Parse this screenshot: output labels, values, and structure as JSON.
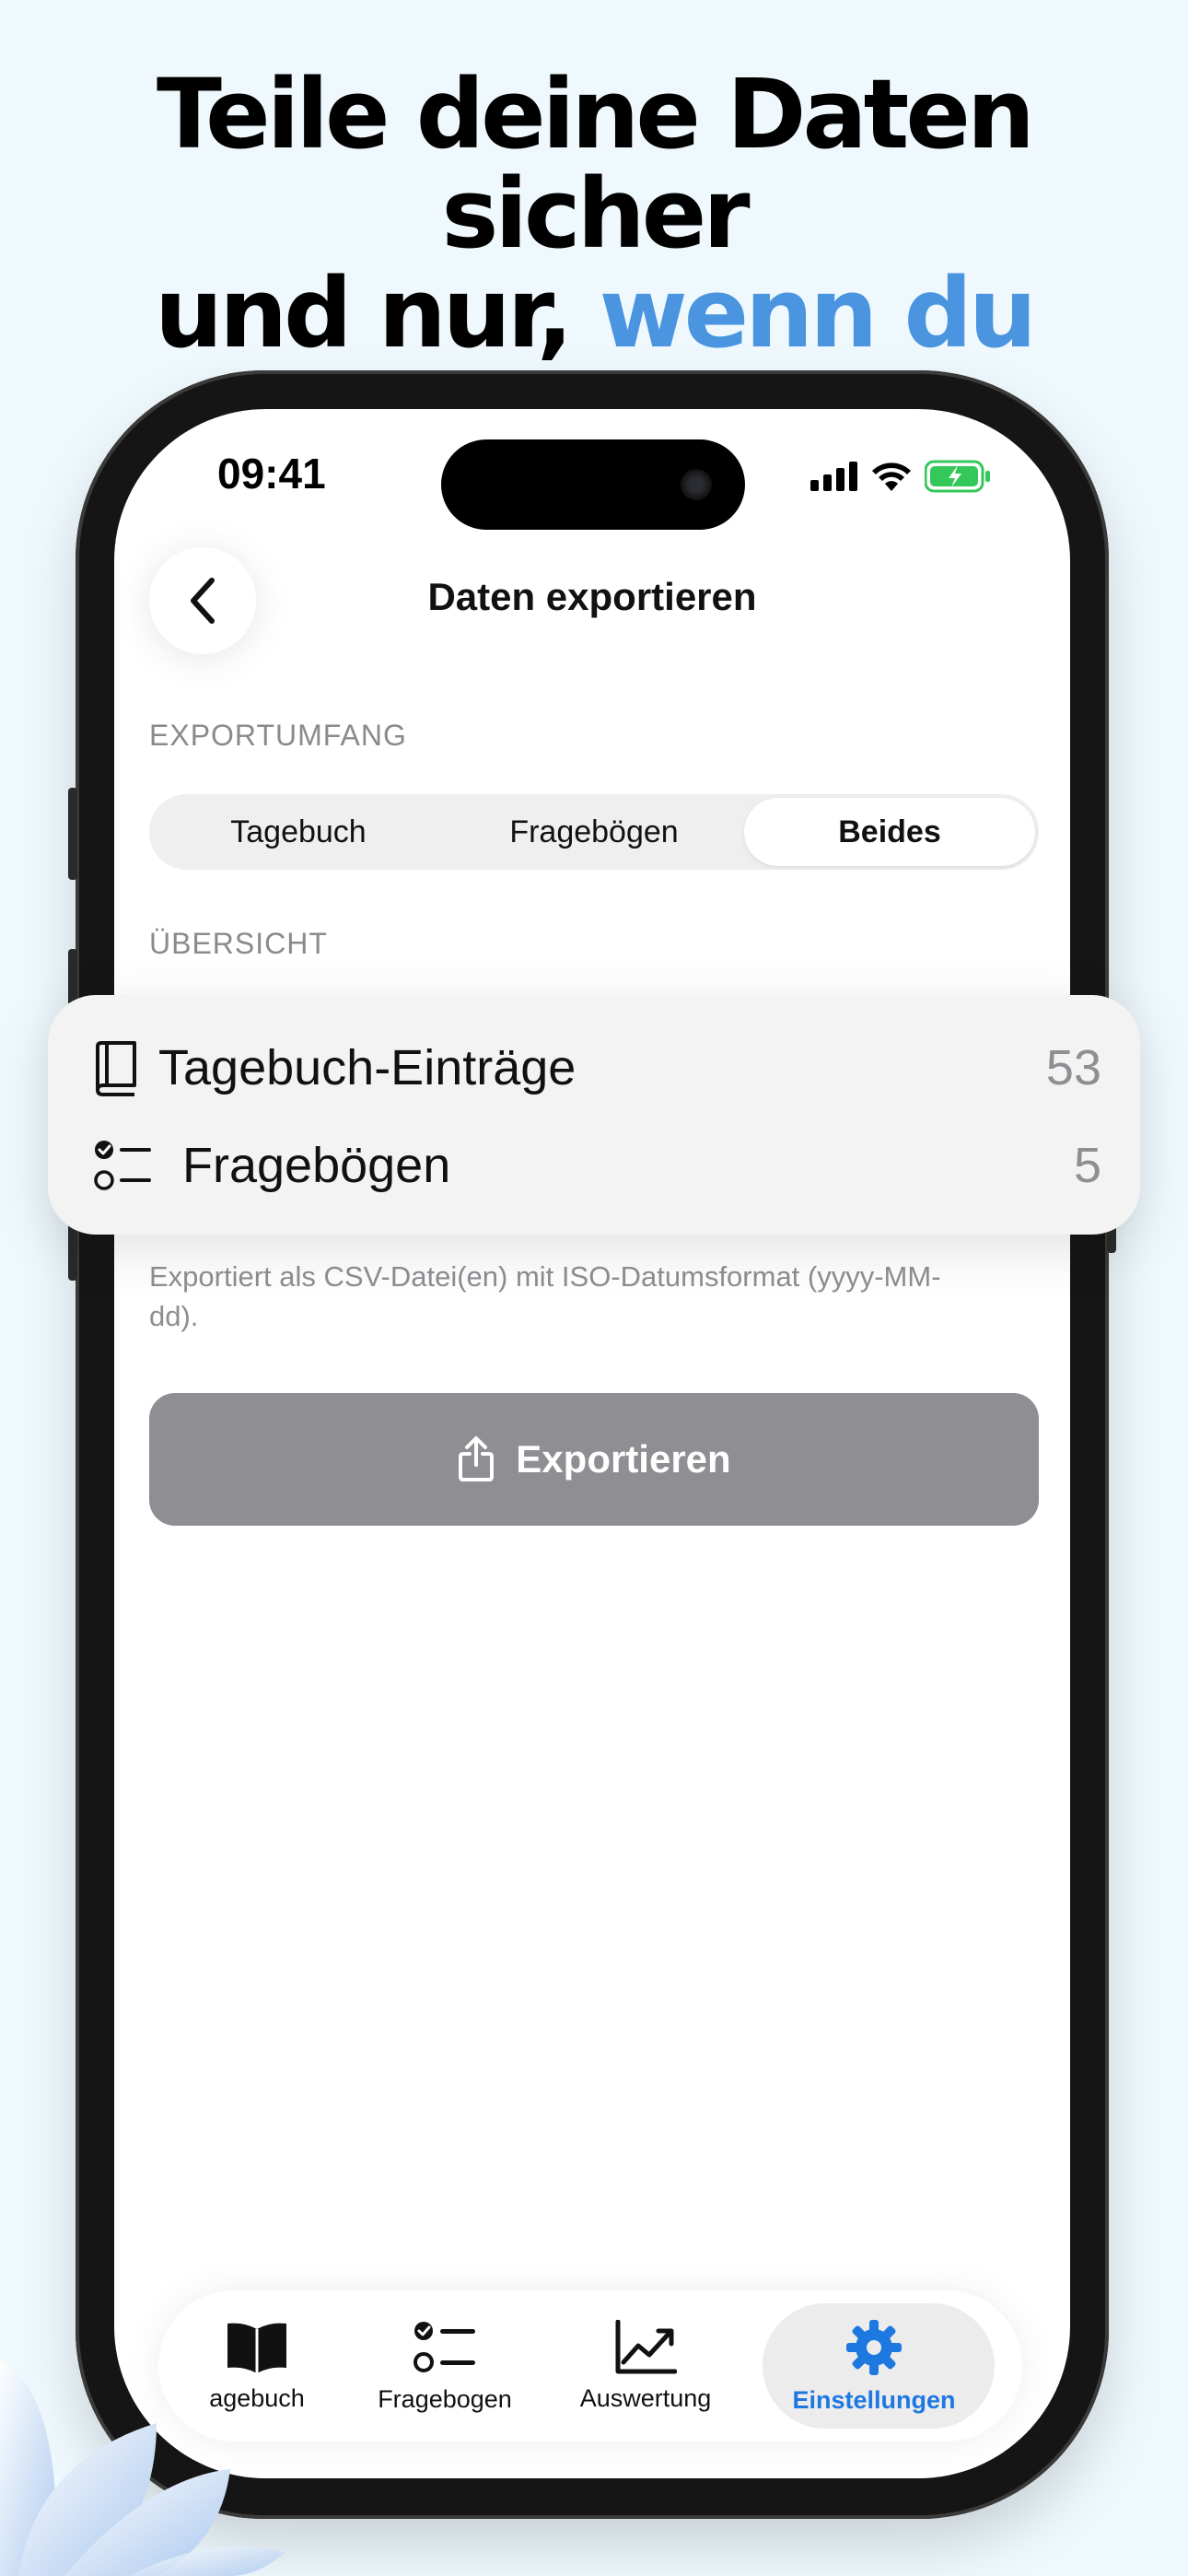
{
  "headline": {
    "line1": "Teile deine Daten sicher",
    "line2_plain": "und nur, ",
    "line2_accent": "wenn du willst."
  },
  "status_bar": {
    "time": "09:41"
  },
  "nav": {
    "title": "Daten exportieren"
  },
  "export_scope": {
    "label": "EXPORTUMFANG",
    "options": [
      "Tagebuch",
      "Fragebögen",
      "Beides"
    ],
    "selected": "Beides"
  },
  "overview": {
    "label": "ÜBERSICHT",
    "rows": [
      {
        "label": "Tagebuch-Einträge",
        "count": "53",
        "icon": "book-icon"
      },
      {
        "label": "Fragebögen",
        "count": "5",
        "icon": "checklist-icon"
      }
    ]
  },
  "hint_text": "Exportiert als CSV-Datei(en) mit ISO-Datumsformat (yyyy-MM-dd).",
  "export_button": {
    "label": "Exportieren",
    "icon": "share-icon",
    "color": "#8e8e93"
  },
  "tabbar": {
    "tabs": [
      {
        "label": "agebuch",
        "icon": "open-book-icon"
      },
      {
        "label": "Fragebogen",
        "icon": "checklist-icon"
      },
      {
        "label": "Auswertung",
        "icon": "chart-icon"
      },
      {
        "label": "Einstellungen",
        "icon": "gear-icon"
      }
    ],
    "active": "Einstellungen"
  },
  "colors": {
    "accent": "#4a94e0",
    "active_tab": "#1d78e0",
    "background": "#eef8fd"
  }
}
